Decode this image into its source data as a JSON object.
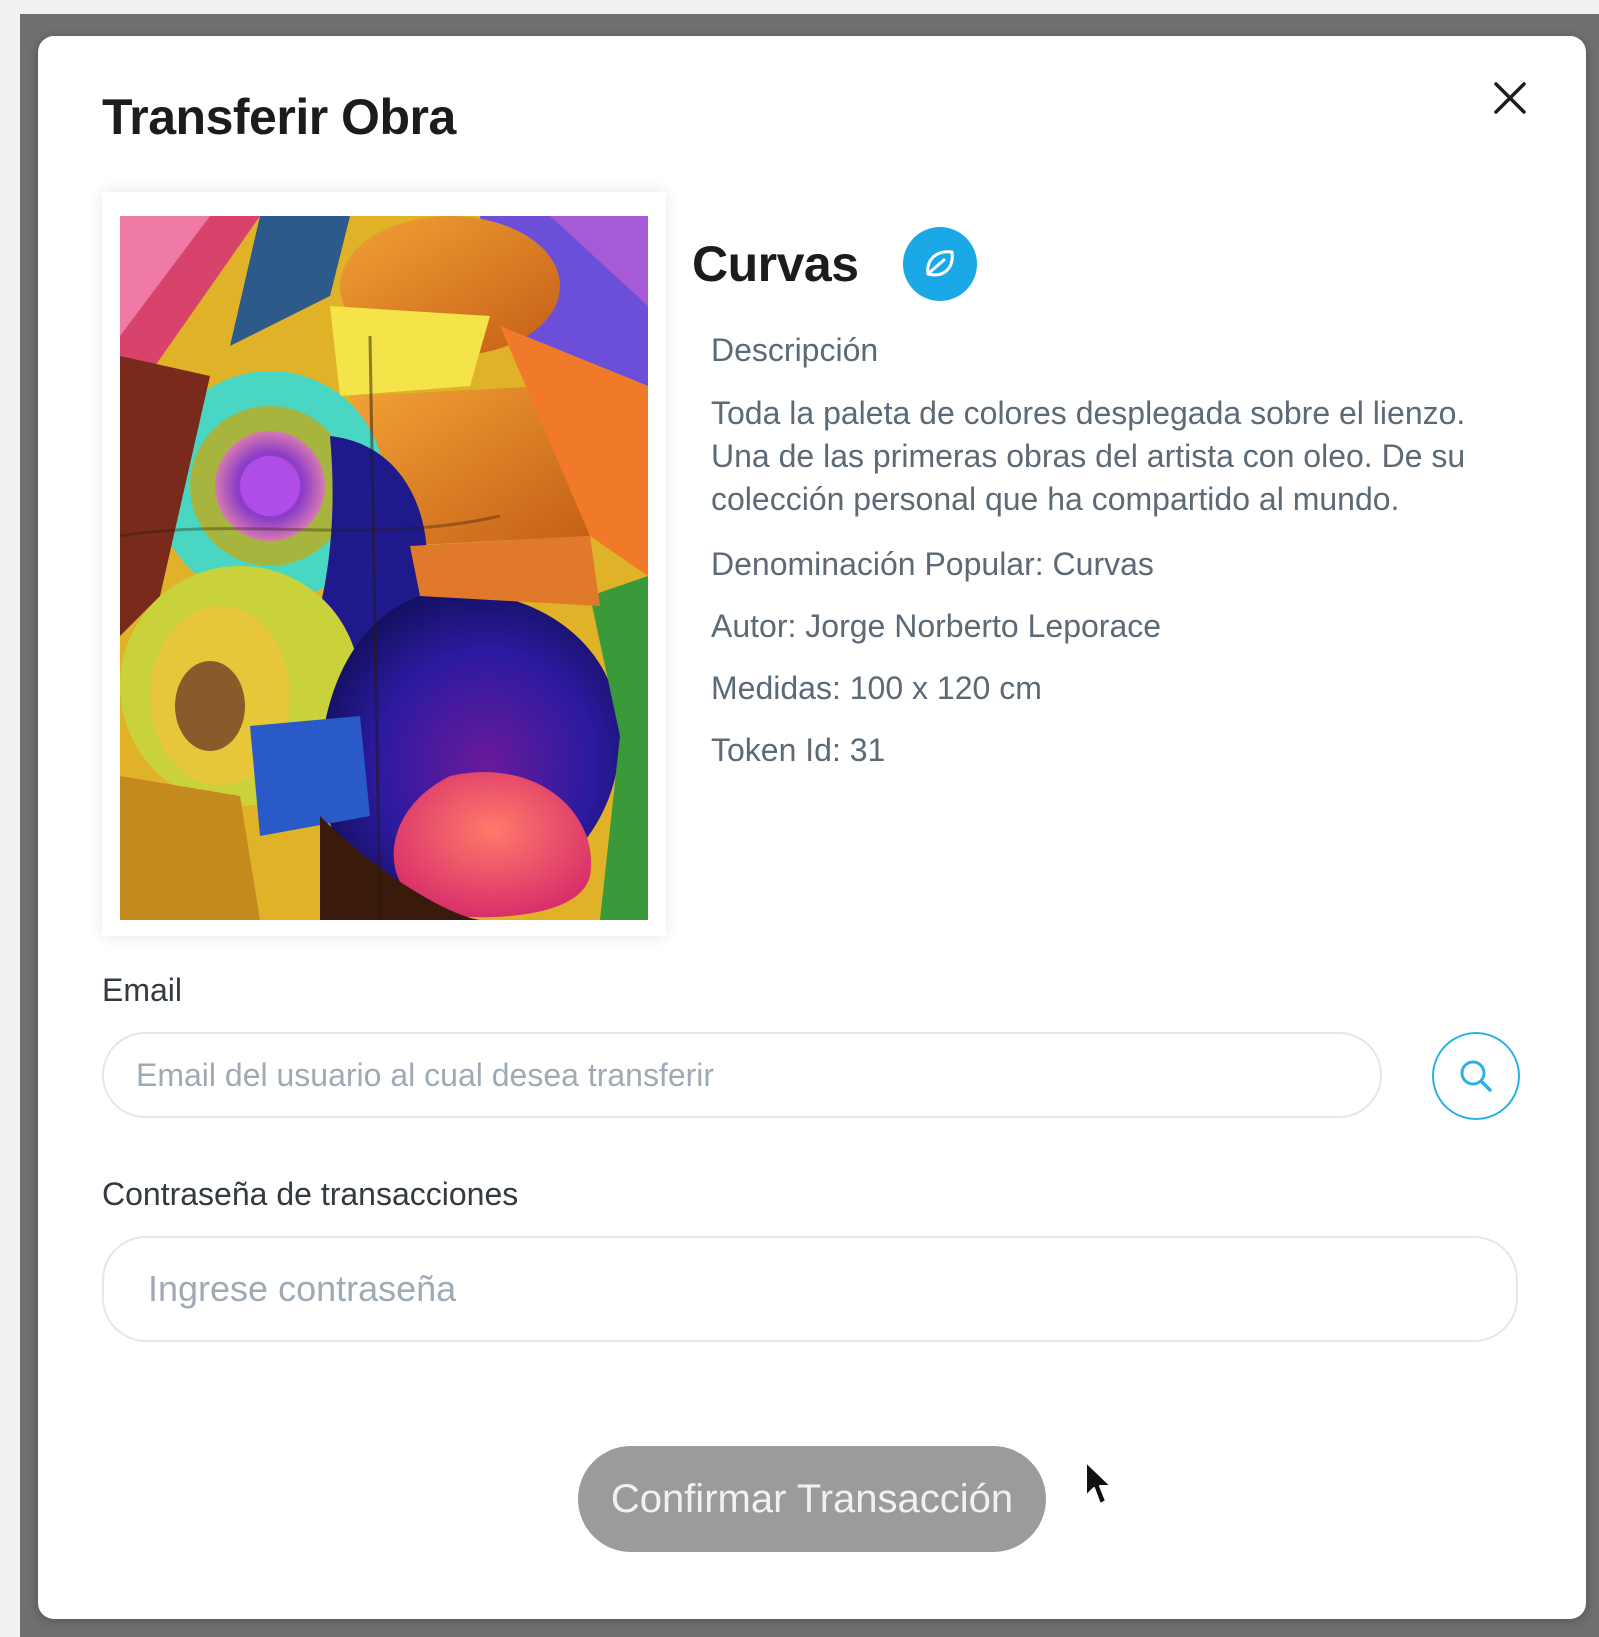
{
  "modal": {
    "title": "Transferir Obra"
  },
  "artwork": {
    "name": "Curvas",
    "badge_icon": "leaf-icon",
    "description_label": "Descripción",
    "description": "Toda la paleta de colores desplegada sobre el lienzo. Una de las primeras obras del artista con oleo. De su colección personal que ha compartido al mundo.",
    "popular_name": "Denominación Popular: Curvas",
    "author": "Autor: Jorge Norberto Leporace",
    "measures": "Medidas: 100 x 120 cm",
    "token_id": "Token Id: 31"
  },
  "form": {
    "email_label": "Email",
    "email_placeholder": "Email del usuario al cual desea transferir",
    "password_label": "Contraseña de transacciones",
    "password_placeholder": "Ingrese contraseña",
    "confirm_label": "Confirmar Transacción"
  },
  "colors": {
    "accent": "#1aa8e6",
    "button_disabled": "#9b9b9b",
    "overlay": "#6f6f6f"
  }
}
